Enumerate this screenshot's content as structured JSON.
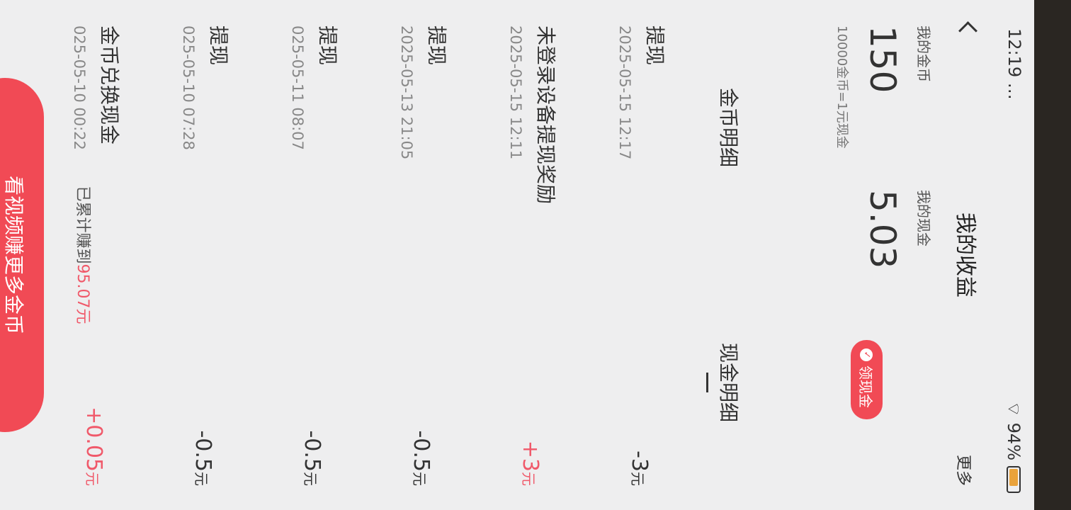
{
  "status_bar": {
    "time": "12:19 …",
    "battery": "94%"
  },
  "nav": {
    "title": "我的收益",
    "more": "更多"
  },
  "wallet": {
    "coins_label": "我的金币",
    "coins_value": "150",
    "coins_note": "10000金币=1元现金",
    "cash_label": "我的现金",
    "cash_value": "5.03",
    "withdraw_label": "领现金"
  },
  "tabs": [
    {
      "label": "金币明细",
      "active": false
    },
    {
      "label": "现金明细",
      "active": true
    }
  ],
  "records": [
    {
      "title": "提现",
      "date": "2025-05-15 12:17",
      "amount": "-3",
      "unit": "元"
    },
    {
      "title": "未登录设备提现奖励",
      "date": "2025-05-15 12:11",
      "amount": "+3",
      "unit": "元"
    },
    {
      "title": "提现",
      "date": "2025-05-13 21:05",
      "amount": "-0.5",
      "unit": "元"
    },
    {
      "title": "提现",
      "date": "025-05-11 08:07",
      "amount": "-0.5",
      "unit": "元"
    },
    {
      "title": "提现",
      "date": "025-05-10 07:28",
      "amount": "-0.5",
      "unit": "元"
    },
    {
      "title": "金币兑换现金",
      "date": "025-05-10 00:22",
      "amount": "+0.05",
      "unit": "元"
    }
  ],
  "total": {
    "prefix": "已累计赚到",
    "amount": "95.07元"
  },
  "cta": {
    "label": "看视频赚更多金币"
  },
  "colors": {
    "accent": "#f14a55",
    "positive": "#f0596a"
  }
}
